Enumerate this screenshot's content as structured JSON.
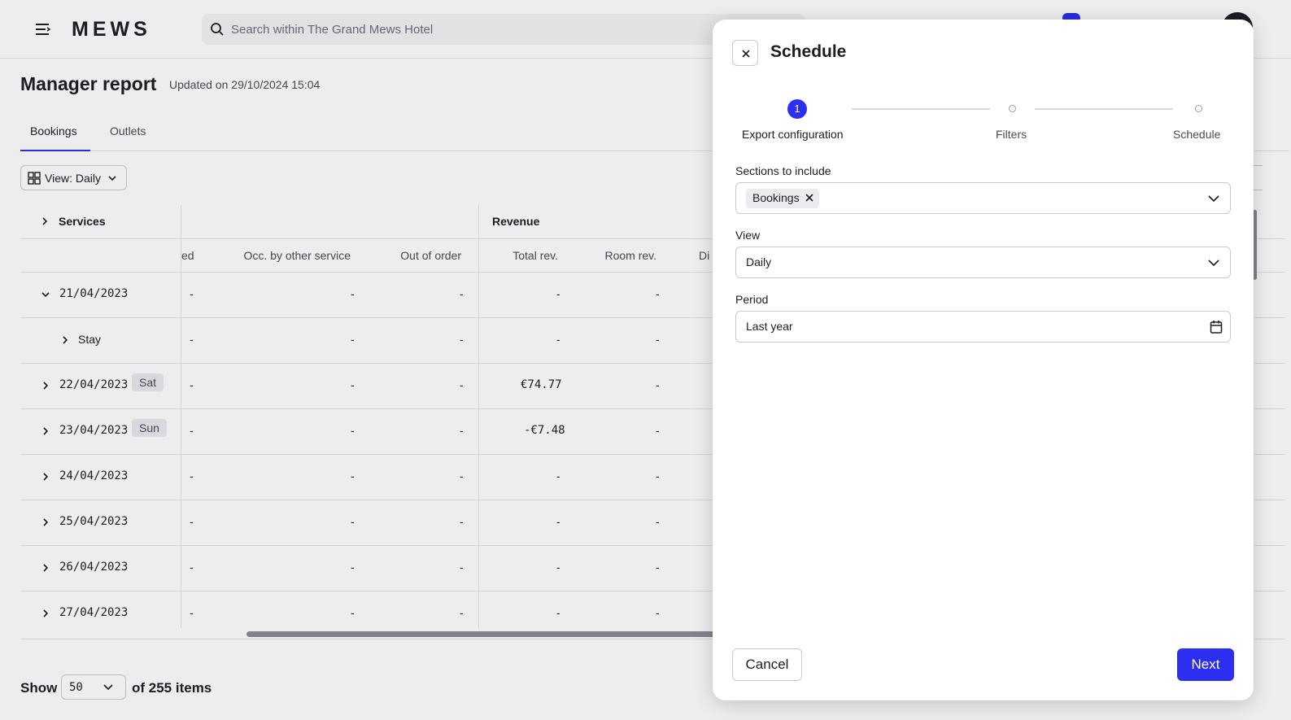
{
  "app": {
    "logo": "MEWS",
    "search_placeholder": "Search within The Grand Mews Hotel"
  },
  "page": {
    "title": "Manager report",
    "updated": "Updated on 29/10/2024 15:04",
    "tabs": [
      {
        "label": "Bookings",
        "active": true
      },
      {
        "label": "Outlets",
        "active": false
      }
    ],
    "view_label": "View: Daily"
  },
  "table": {
    "services_label": "Services",
    "revenue_group": "Revenue",
    "columns": [
      "ed",
      "Occ. by other service",
      "Out of order",
      "Total rev.",
      "Room rev.",
      "Di"
    ],
    "rows": [
      {
        "date": "21/04/2023",
        "day": "",
        "expanded": true,
        "values": [
          "-",
          "-",
          "-",
          "-",
          "-"
        ]
      },
      {
        "date": "Stay",
        "day": "",
        "child": true,
        "values": [
          "-",
          "-",
          "-",
          "-",
          "-"
        ]
      },
      {
        "date": "22/04/2023",
        "day": "Sat",
        "values": [
          "-",
          "-",
          "-",
          "€74.77",
          "-"
        ]
      },
      {
        "date": "23/04/2023",
        "day": "Sun",
        "values": [
          "-",
          "-",
          "-",
          "-€7.48",
          "-"
        ]
      },
      {
        "date": "24/04/2023",
        "day": "",
        "values": [
          "-",
          "-",
          "-",
          "-",
          "-"
        ]
      },
      {
        "date": "25/04/2023",
        "day": "",
        "values": [
          "-",
          "-",
          "-",
          "-",
          "-"
        ]
      },
      {
        "date": "26/04/2023",
        "day": "",
        "values": [
          "-",
          "-",
          "-",
          "-",
          "-"
        ]
      },
      {
        "date": "27/04/2023",
        "day": "",
        "values": [
          "-",
          "-",
          "-",
          "-",
          "-"
        ]
      }
    ]
  },
  "pagination": {
    "show_label": "Show",
    "page_size": "50",
    "of_items": "of 255 items"
  },
  "modal": {
    "title": "Schedule",
    "steps": [
      {
        "number": "1",
        "label": "Export configuration",
        "active": true
      },
      {
        "number": "",
        "label": "Filters",
        "active": false
      },
      {
        "number": "",
        "label": "Schedule",
        "active": false
      }
    ],
    "sections_label": "Sections to include",
    "sections_chip": "Bookings",
    "view_label": "View",
    "view_value": "Daily",
    "period_label": "Period",
    "period_value": "Last year",
    "cancel_label": "Cancel",
    "next_label": "Next"
  },
  "colors": {
    "accent": "#2c2ff0",
    "text": "#1c1d24",
    "border": "#c9c9d1"
  }
}
